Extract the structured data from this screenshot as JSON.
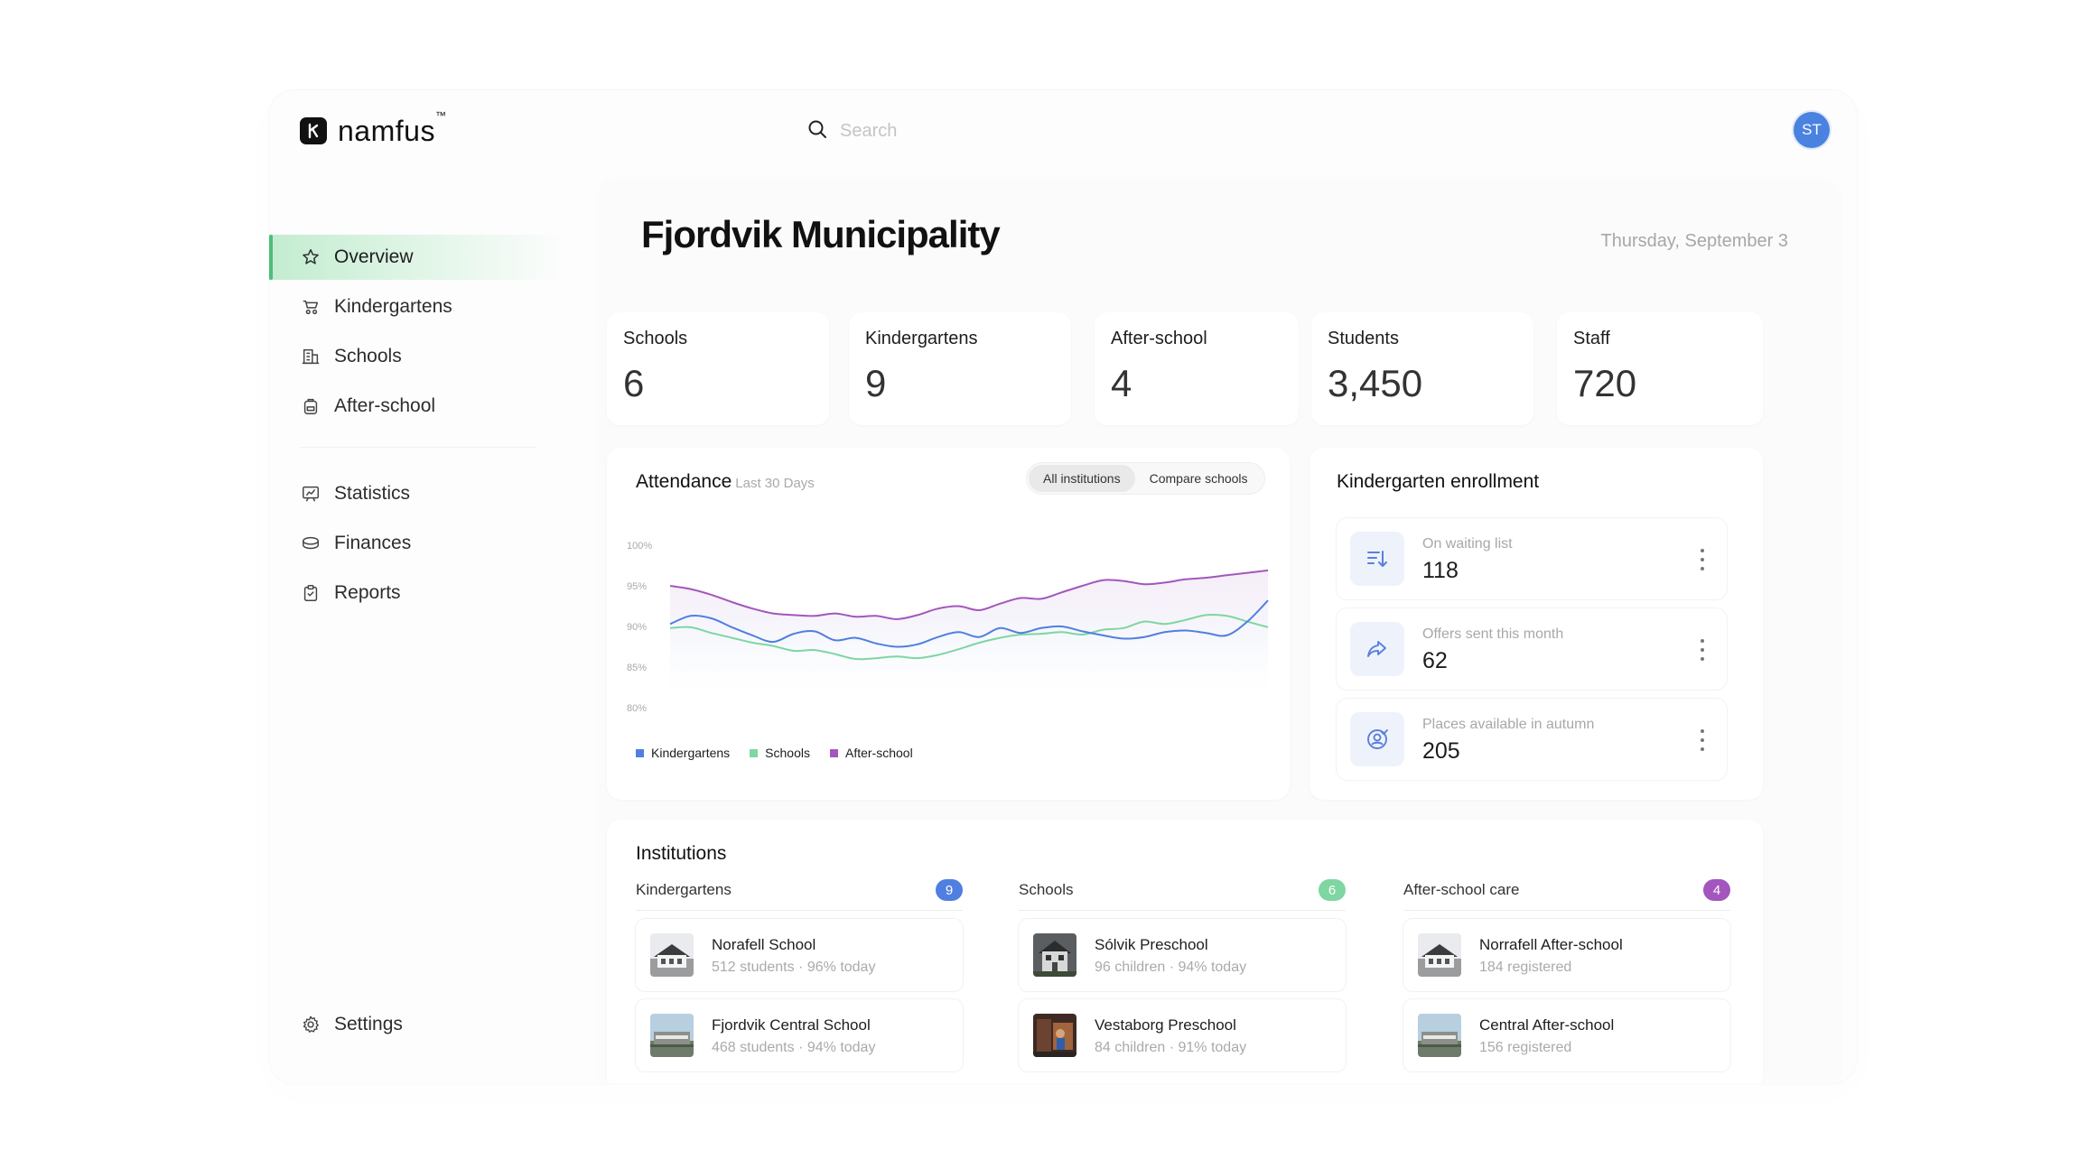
{
  "brand": {
    "name": "namfus",
    "tm": "™"
  },
  "search": {
    "placeholder": "Search"
  },
  "user": {
    "initials": "ST"
  },
  "sidebar": {
    "items": [
      {
        "label": "Overview",
        "icon": "star-icon",
        "active": true
      },
      {
        "label": "Kindergartens",
        "icon": "stroller-icon"
      },
      {
        "label": "Schools",
        "icon": "building-icon"
      },
      {
        "label": "After-school",
        "icon": "backpack-icon"
      },
      {
        "label": "Statistics",
        "icon": "presentation-chart-icon"
      },
      {
        "label": "Finances",
        "icon": "coins-icon"
      },
      {
        "label": "Reports",
        "icon": "clipboard-icon"
      }
    ],
    "settings": {
      "label": "Settings",
      "icon": "gear-icon"
    }
  },
  "header": {
    "title": "Fjordvik Municipality",
    "date": "Thursday, September 3"
  },
  "stats": [
    {
      "label": "Schools",
      "value": "6"
    },
    {
      "label": "Kindergartens",
      "value": "9"
    },
    {
      "label": "After-school",
      "value": "4"
    },
    {
      "label": "Students",
      "value": "3,450"
    },
    {
      "label": "Staff",
      "value": "720"
    }
  ],
  "attendance": {
    "title": "Attendance",
    "subtitle": "Last 30 Days",
    "toggle": {
      "all": "All institutions",
      "compare": "Compare schools",
      "selected": "all"
    }
  },
  "chart_data": {
    "type": "line",
    "title": "Attendance",
    "subtitle": "Last 30 Days",
    "y_ticks": [
      "100%",
      "95%",
      "90%",
      "85%",
      "80%"
    ],
    "ylim": [
      80,
      100
    ],
    "x": [
      1,
      2,
      3,
      4,
      5,
      6,
      7,
      8,
      9,
      10,
      11,
      12,
      13,
      14,
      15,
      16,
      17,
      18,
      19,
      20,
      21,
      22,
      23,
      24,
      25,
      26,
      27,
      28,
      29,
      30
    ],
    "grid": false,
    "legend": "bottom-left",
    "series": [
      {
        "name": "Kindergartens",
        "color": "#4f7fe0",
        "values": [
          90.3,
          91.3,
          91.0,
          89.9,
          88.9,
          88.1,
          89.1,
          89.4,
          88.3,
          88.6,
          87.9,
          87.5,
          87.8,
          88.7,
          89.3,
          88.7,
          89.8,
          89.2,
          89.8,
          90.0,
          89.4,
          88.9,
          88.5,
          88.7,
          89.3,
          89.5,
          89.2,
          88.9,
          90.6,
          93.2
        ]
      },
      {
        "name": "Schools",
        "color": "#7ed6a2",
        "values": [
          89.8,
          89.9,
          89.2,
          88.6,
          88.0,
          87.6,
          87.0,
          87.1,
          86.6,
          86.0,
          86.1,
          86.3,
          86.1,
          86.5,
          87.2,
          88.0,
          88.6,
          89.0,
          89.1,
          89.3,
          89.0,
          89.6,
          89.8,
          90.6,
          90.3,
          90.8,
          91.4,
          91.3,
          90.6,
          89.9
        ]
      },
      {
        "name": "After-school",
        "color": "#a356bd",
        "values": [
          95.0,
          94.6,
          93.9,
          93.0,
          92.2,
          91.6,
          91.4,
          91.3,
          91.6,
          91.2,
          91.3,
          90.9,
          91.4,
          92.2,
          92.5,
          92.0,
          92.8,
          93.5,
          93.4,
          94.2,
          95.0,
          95.7,
          95.6,
          95.2,
          95.4,
          95.8,
          96.0,
          96.3,
          96.6,
          96.9
        ]
      }
    ]
  },
  "enrollment": {
    "title": "Kindergarten enrollment",
    "rows": [
      {
        "label": "On waiting list",
        "value": "118",
        "icon": "sort-down-icon"
      },
      {
        "label": "Offers sent this month",
        "value": "62",
        "icon": "share-arrow-icon"
      },
      {
        "label": "Places available in autumn",
        "value": "205",
        "icon": "user-check-icon"
      }
    ]
  },
  "institutions": {
    "title": "Institutions",
    "columns": [
      {
        "title": "Kindergartens",
        "count": "9",
        "color": "#4f7fe0",
        "items": [
          {
            "name": "Norafell School",
            "meta": "512 students · 96% today",
            "thumb": "building-photo"
          },
          {
            "name": "Fjordvik Central School",
            "meta": "468 students · 94% today",
            "thumb": "school-photo"
          }
        ]
      },
      {
        "title": "Schools",
        "count": "6",
        "color": "#7ed6a2",
        "items": [
          {
            "name": "Sólvik Preschool",
            "meta": "96 children · 94% today",
            "thumb": "preschool-photo"
          },
          {
            "name": "Vestaborg Preschool",
            "meta": "84 children · 91% today",
            "thumb": "playground-photo"
          }
        ]
      },
      {
        "title": "After-school care",
        "count": "4",
        "color": "#a356bd",
        "items": [
          {
            "name": "Norrafell After-school",
            "meta": "184 registered",
            "thumb": "building-photo"
          },
          {
            "name": "Central After-school",
            "meta": "156 registered",
            "thumb": "school-photo"
          }
        ]
      }
    ]
  }
}
